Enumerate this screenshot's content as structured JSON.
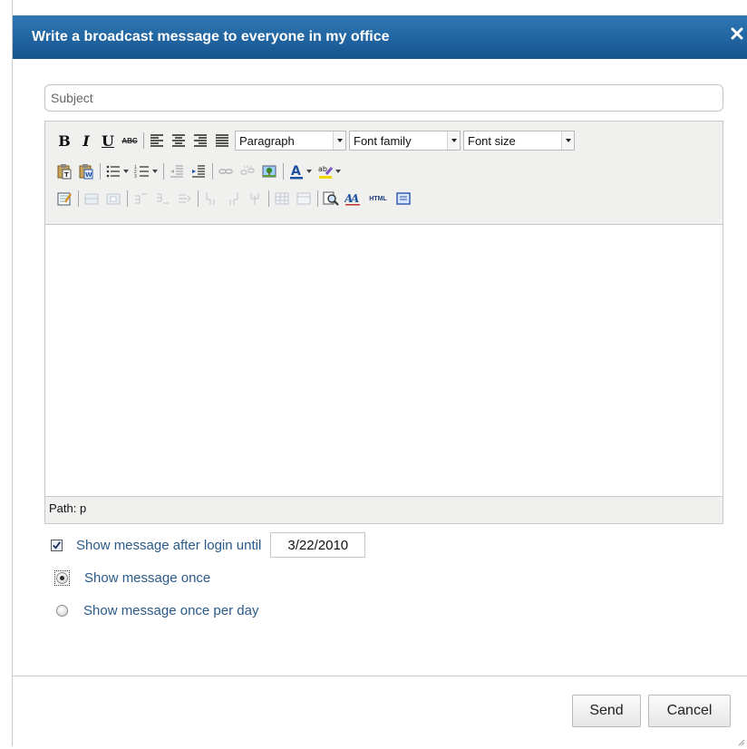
{
  "dialog": {
    "title": "Write a broadcast message to everyone in my office"
  },
  "subject": {
    "placeholder": "Subject",
    "value": ""
  },
  "editor": {
    "toolbar": {
      "block_format": "Paragraph",
      "font_family": "Font family",
      "font_size": "Font size",
      "bold_label": "B",
      "italic_label": "I",
      "underline_label": "U",
      "strike_label": "ABC",
      "html_label": "HTML"
    },
    "status_path": "Path: p",
    "body_content": ""
  },
  "options": {
    "show_after_login_label": "Show message after login until",
    "show_after_login_checked": true,
    "until_date": "3/22/2010",
    "radio_once_label": "Show message once",
    "radio_once_per_day_label": "Show message once per day",
    "selected_radio": "once"
  },
  "buttons": {
    "send_label": "Send",
    "cancel_label": "Cancel"
  },
  "colors": {
    "title_bar_top": "#2f78b4",
    "title_bar_bottom": "#15548f",
    "option_text": "#2a5a8a"
  },
  "icons": {
    "close": "close-icon",
    "paste_text": "paste-as-text-icon",
    "paste_word": "paste-from-word-icon",
    "bullet_list": "bullet-list-icon",
    "numbered_list": "numbered-list-icon",
    "outdent": "outdent-icon",
    "indent": "indent-icon",
    "link": "link-icon",
    "unlink": "unlink-icon",
    "image": "image-icon",
    "text_color": "text-color-icon",
    "highlight": "highlight-color-icon",
    "preview": "preview-icon",
    "styles": "styles-icon",
    "fullscreen": "fullscreen-icon"
  }
}
